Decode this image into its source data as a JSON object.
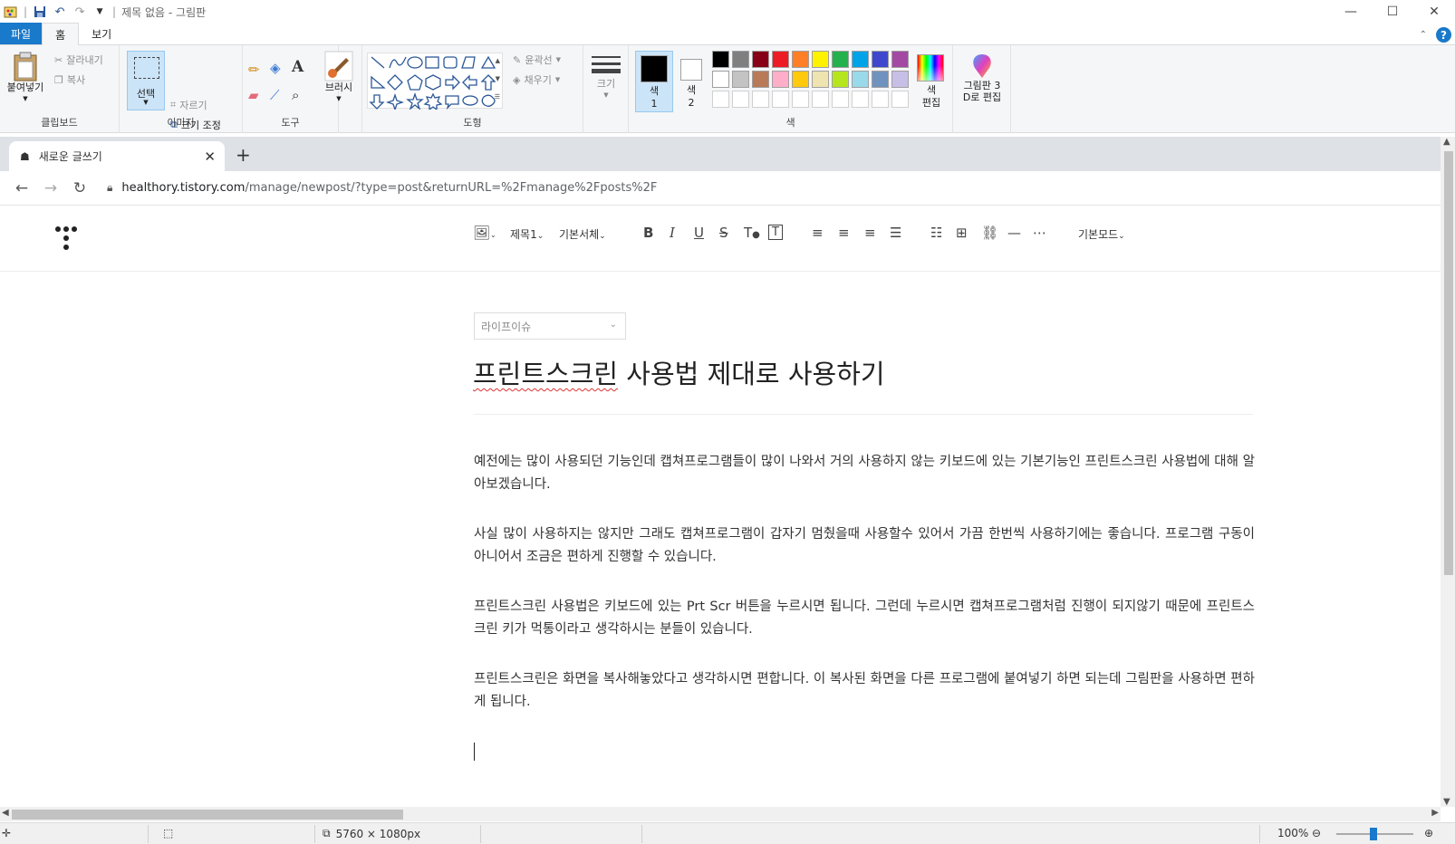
{
  "window": {
    "title": "제목 없음 - 그림판",
    "qat_separator": "|"
  },
  "ribbon_tabs": [
    "파일",
    "홈",
    "보기"
  ],
  "ribbon": {
    "clipboard": {
      "paste": "붙여넣기",
      "cut": "잘라내기",
      "copy": "복사",
      "label": "클립보드"
    },
    "image": {
      "select": "선택",
      "crop": "자르기",
      "resize": "크기 조정",
      "rotate": "회전",
      "label": "이미지"
    },
    "tools": {
      "label": "도구"
    },
    "brush": {
      "label": "브러시"
    },
    "shapes": {
      "outline": "윤곽선",
      "fill": "채우기",
      "label": "도형"
    },
    "size": {
      "label": "크기"
    },
    "colors": {
      "color1_label": "색\n1",
      "color2_label": "색\n2",
      "edit_label": "색\n편집",
      "label": "색",
      "palette": [
        "#000000",
        "#7f7f7f",
        "#880015",
        "#ed1c24",
        "#ff7f27",
        "#fff200",
        "#22b14c",
        "#00a2e8",
        "#3f48cc",
        "#a349a4",
        "#ffffff",
        "#c3c3c3",
        "#b97a57",
        "#ffaec9",
        "#ffc90e",
        "#efe4b0",
        "#b5e61d",
        "#99d9ea",
        "#7092be",
        "#c8bfe7"
      ],
      "color1": "#000000",
      "color2": "#ffffff"
    },
    "paint3d": {
      "label": "그림판 3\nD로 편집"
    }
  },
  "browser": {
    "tab_title": "새로운 글쓰기",
    "url_host": "healthory.tistory.com",
    "url_path": "/manage/newpost/?type=post&returnURL=%2Fmanage%2Fposts%2F"
  },
  "editor_toolbar": {
    "heading": "제목1",
    "font": "기본서체",
    "mode": "기본모드"
  },
  "post": {
    "category": "라이프이슈",
    "title_part1": "프린트스크린",
    "title_part2": " 사용법 제대로 사용하기",
    "paragraphs": [
      "예전에는 많이 사용되던 기능인데 캡쳐프로그램들이 많이 나와서 거의 사용하지 않는 키보드에 있는 기본기능인 프린트스크린 사용법에 대해 알아보겠습니다.",
      "사실 많이 사용하지는 않지만 그래도 캡쳐프로그램이 갑자기 멈췄을때 사용할수 있어서 가끔 한번씩 사용하기에는 좋습니다. 프로그램 구동이 아니어서 조금은 편하게 진행할 수 있습니다.",
      "프린트스크린 사용법은 키보드에 있는 Prt Scr 버튼을 누르시면 됩니다. 그런데 누르시면 캡쳐프로그램처럼 진행이 되지않기 때문에 프린트스크린 키가 먹통이라고 생각하시는 분들이 있습니다.",
      "프린트스크린은 화면을 복사해놓았다고 생각하시면 편합니다. 이 복사된 화면을 다른 프로그램에 붙여넣기 하면 되는데 그림판을 사용하면 편하게 됩니다."
    ]
  },
  "statusbar": {
    "dimensions": "5760 × 1080px",
    "zoom": "100%"
  }
}
